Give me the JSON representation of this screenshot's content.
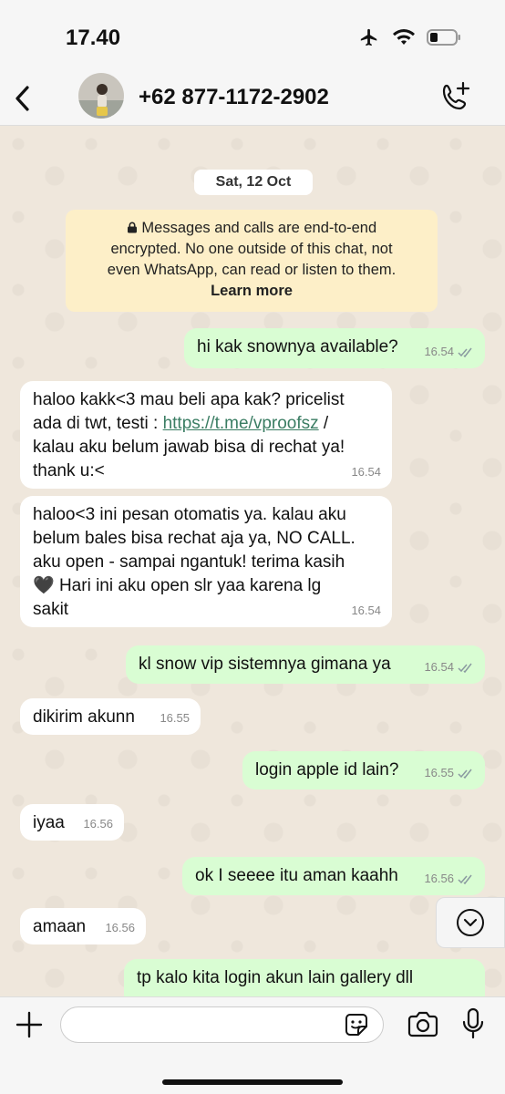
{
  "status": {
    "time": "17.40"
  },
  "header": {
    "contact": "+62 877-1172-2902"
  },
  "chat": {
    "date": "Sat, 12 Oct",
    "encryption": {
      "line1": "Messages and calls are end-to-end",
      "line2": "encrypted. No one outside of this chat, not",
      "line3": "even WhatsApp, can read or listen to them.",
      "learn_more": "Learn more"
    },
    "messages": [
      {
        "text": "hi kak snownya available?",
        "time": "16.54"
      },
      {
        "line1": "haloo kakk<3 mau beli apa kak? pricelist",
        "line2_pre": "ada di twt, testi : ",
        "link": "https://t.me/vproofsz",
        "line2_post": " /",
        "line3": "kalau aku belum jawab bisa di rechat ya!",
        "line4": "thank u:<",
        "time": "16.54"
      },
      {
        "line1": "haloo<3 ini pesan otomatis ya. kalau aku",
        "line2": "belum bales bisa rechat aja ya, NO CALL.",
        "line3": "aku open - sampai ngantuk! terima kasih",
        "heart": "🖤",
        "line4": " Hari ini aku open slr yaa karena lg",
        "line5": "sakit",
        "time": "16.54"
      },
      {
        "text": "kl snow vip sistemnya gimana ya",
        "time": "16.54"
      },
      {
        "text": "dikirim akunn",
        "time": "16.55"
      },
      {
        "text": "login apple id lain?",
        "time": "16.55"
      },
      {
        "text": "iyaa",
        "time": "16.56"
      },
      {
        "text": "ok I seeee itu aman kaahh",
        "time": "16.56"
      },
      {
        "text": "amaan",
        "time": "16.56"
      },
      {
        "text": "tp kalo kita login akun lain gallery dll"
      }
    ]
  },
  "composer": {
    "placeholder": ""
  },
  "colors": {
    "outgoing": "#d9fdd3",
    "incoming": "#ffffff",
    "notice": "#fdefc8",
    "ticks": "#8a9aa0"
  }
}
